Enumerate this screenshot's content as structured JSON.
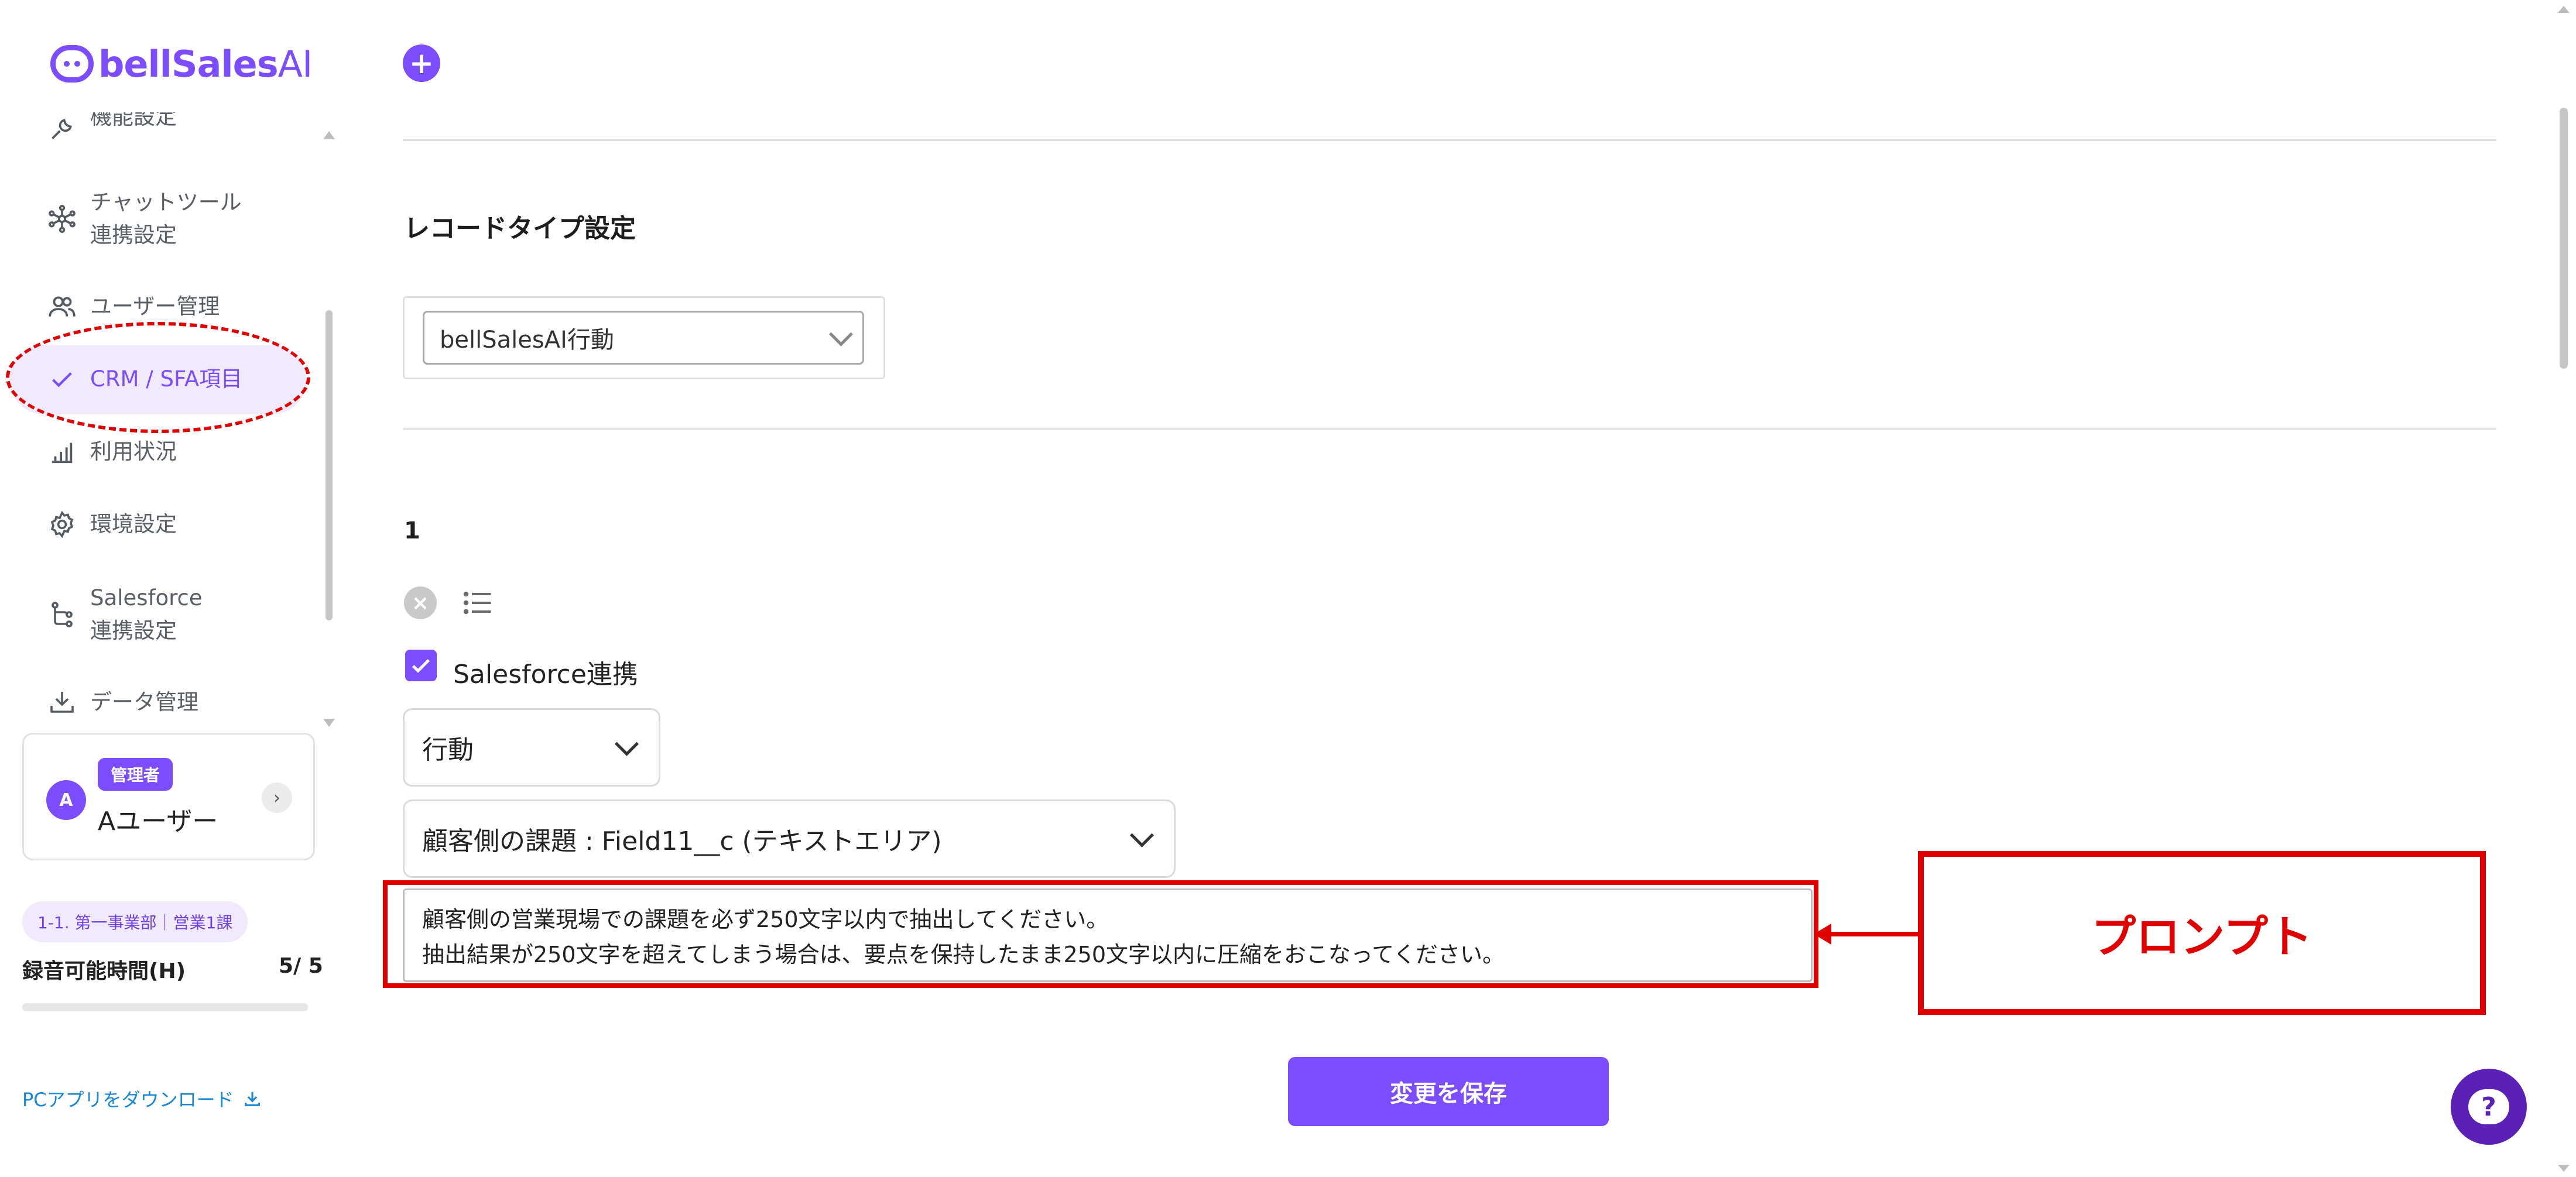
{
  "app": {
    "logo_main": "bellSales",
    "logo_ai": "AI"
  },
  "sidebar": {
    "items": [
      {
        "label": "機能設定",
        "icon": "tool-icon"
      },
      {
        "label": "チャットツール",
        "label2": "連携設定",
        "icon": "network-icon"
      },
      {
        "label": "ユーザー管理",
        "icon": "users-icon"
      },
      {
        "label": "CRM / SFA項目",
        "icon": "check-icon",
        "active": true
      },
      {
        "label": "利用状況",
        "icon": "bar-chart-icon"
      },
      {
        "label": "環境設定",
        "icon": "gear-icon"
      },
      {
        "label": "Salesforce",
        "label2": "連携設定",
        "icon": "branch-icon"
      },
      {
        "label": "データ管理",
        "icon": "download-tray-icon"
      }
    ],
    "user": {
      "avatar": "A",
      "role": "管理者",
      "name": "Aユーザー"
    },
    "team": "1-1. 第一事業部｜営業1課",
    "recording": {
      "label": "録音可能時間(H)",
      "value": "5/ 5",
      "progress": 0
    },
    "download_link": "PCアプリをダウンロード"
  },
  "main": {
    "section_title": "レコードタイプ設定",
    "record_type": "bellSalesAI行動",
    "item_number": "1",
    "salesforce_checkbox": {
      "label": "Salesforce連携",
      "checked": true
    },
    "object_select": "行動",
    "field_select": "顧客側の課題 : Field11__c (テキストエリア)",
    "prompt": "顧客側の営業現場での課題を必ず250文字以内で抽出してください。\n抽出結果が250文字を超えてしまう場合は、要点を保持したまま250文字以内に圧縮をおこなってください。",
    "save_label": "変更を保存"
  },
  "annotation": {
    "callout_label": "プロンプト"
  },
  "colors": {
    "accent": "#7c4dff",
    "annotation": "#e00000",
    "link": "#1a86d6"
  }
}
